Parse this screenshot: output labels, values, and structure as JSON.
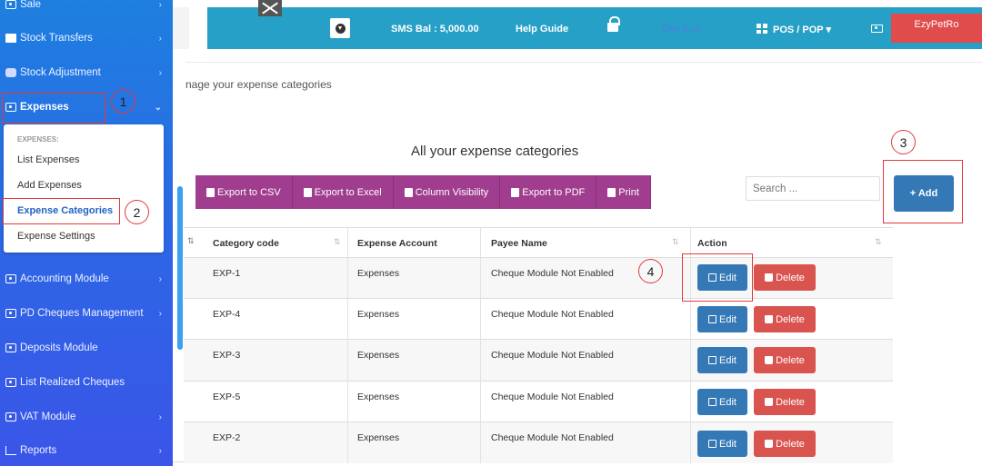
{
  "sidebar": {
    "items": [
      {
        "label": "Sale"
      },
      {
        "label": "Stock Transfers"
      },
      {
        "label": "Stock Adjustment"
      },
      {
        "label": "Expenses"
      },
      {
        "label": "Accounting Module"
      },
      {
        "label": "PD Cheques Management"
      },
      {
        "label": "Deposits Module"
      },
      {
        "label": "List Realized Cheques"
      },
      {
        "label": "VAT Module"
      },
      {
        "label": "Reports"
      }
    ],
    "submenu": {
      "header": "EXPENSES:",
      "items": [
        "List Expenses",
        "Add Expenses",
        "Expense Categories",
        "Expense Settings"
      ]
    }
  },
  "topbar": {
    "sms_balance": "SMS Bal : 5,000.00",
    "help_guide": "Help Guide",
    "faded_text": "Day End",
    "pos_menu": "POS / POP ▾",
    "account": "EzyPetRo"
  },
  "page": {
    "subtitle": "nage your expense categories",
    "table_title": "All your expense categories"
  },
  "toolbar": {
    "exports": [
      "Export to CSV",
      "Export to Excel",
      "Column Visibility",
      "Export to PDF",
      "Print"
    ],
    "search_placeholder": "Search ...",
    "add_label": "+ Add"
  },
  "table": {
    "columns": [
      "Category code",
      "Expense Account",
      "Payee Name",
      "Action"
    ],
    "rows": [
      {
        "code": "EXP-1",
        "account": "Expenses",
        "payee": "Cheque Module Not Enabled"
      },
      {
        "code": "EXP-4",
        "account": "Expenses",
        "payee": "Cheque Module Not Enabled"
      },
      {
        "code": "EXP-3",
        "account": "Expenses",
        "payee": "Cheque Module Not Enabled"
      },
      {
        "code": "EXP-5",
        "account": "Expenses",
        "payee": "Cheque Module Not Enabled"
      },
      {
        "code": "EXP-2",
        "account": "Expenses",
        "payee": "Cheque Module Not Enabled"
      }
    ],
    "edit_label": "Edit",
    "delete_label": "Delete"
  },
  "annotations": [
    "1",
    "2",
    "3",
    "4"
  ],
  "colors": {
    "sidebar": "#2f63e6",
    "topbar": "#26a0c6",
    "export_button": "#a03d8e",
    "primary_button": "#3479b5",
    "danger_button": "#d9534f",
    "annotation": "#e23a3a"
  }
}
